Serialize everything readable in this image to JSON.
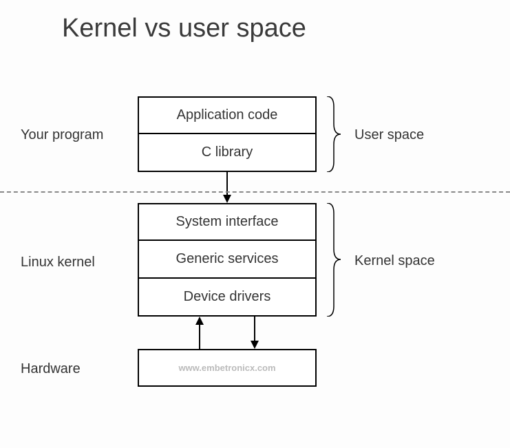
{
  "title": "Kernel vs user space",
  "boxes": {
    "app_code": "Application code",
    "c_library": "C library",
    "system_interface": "System interface",
    "generic_services": "Generic services",
    "device_drivers": "Device drivers",
    "hardware": ""
  },
  "labels": {
    "your_program": "Your program",
    "linux_kernel": "Linux kernel",
    "hardware": "Hardware",
    "user_space": "User space",
    "kernel_space": "Kernel space"
  },
  "watermark": "www.embetronicx.com"
}
